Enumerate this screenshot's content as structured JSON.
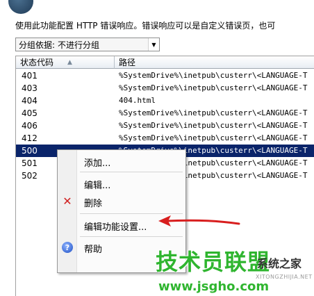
{
  "description": "使用此功能配置 HTTP 错误响应。错误响应可以是自定义错误页，也可",
  "groupby": {
    "label": "分组依据:",
    "value": "不进行分组"
  },
  "columns": {
    "status": "状态代码",
    "path": "路径"
  },
  "rows": [
    {
      "code": "401",
      "path": "%SystemDrive%\\inetpub\\custerr\\<LANGUAGE-T",
      "selected": false
    },
    {
      "code": "403",
      "path": "%SystemDrive%\\inetpub\\custerr\\<LANGUAGE-T",
      "selected": false
    },
    {
      "code": "404",
      "path": "404.html",
      "selected": false
    },
    {
      "code": "405",
      "path": "%SystemDrive%\\inetpub\\custerr\\<LANGUAGE-T",
      "selected": false
    },
    {
      "code": "406",
      "path": "%SystemDrive%\\inetpub\\custerr\\<LANGUAGE-T",
      "selected": false
    },
    {
      "code": "412",
      "path": "%SystemDrive%\\inetpub\\custerr\\<LANGUAGE-T",
      "selected": false
    },
    {
      "code": "500",
      "path": "%SystemDrive%\\inetpub\\custerr\\<LANGUAGE-T",
      "selected": true
    },
    {
      "code": "501",
      "path": "%SystemDrive%\\inetpub\\custerr\\<LANGUAGE-T",
      "selected": false
    },
    {
      "code": "502",
      "path": "%SystemDrive%\\inetpub\\custerr\\<LANGUAGE-T",
      "selected": false
    }
  ],
  "context_menu": {
    "add": "添加...",
    "edit": "编辑...",
    "delete": "删除",
    "edit_feature_settings": "编辑功能设置...",
    "help": "帮助"
  },
  "icons": {
    "delete": "x-icon",
    "help": "help-icon",
    "dropdown": "chevron-down-icon",
    "sort": "sort-asc-icon"
  },
  "colors": {
    "selection": "#0a246a",
    "annotation_arrow": "#d81e1e",
    "watermark": "#2fb52f"
  },
  "watermark": {
    "main": "技术员联盟",
    "side": "系统之家",
    "url": "www.jsgho.com",
    "sub": "XITONGZHIJIA.NET"
  }
}
